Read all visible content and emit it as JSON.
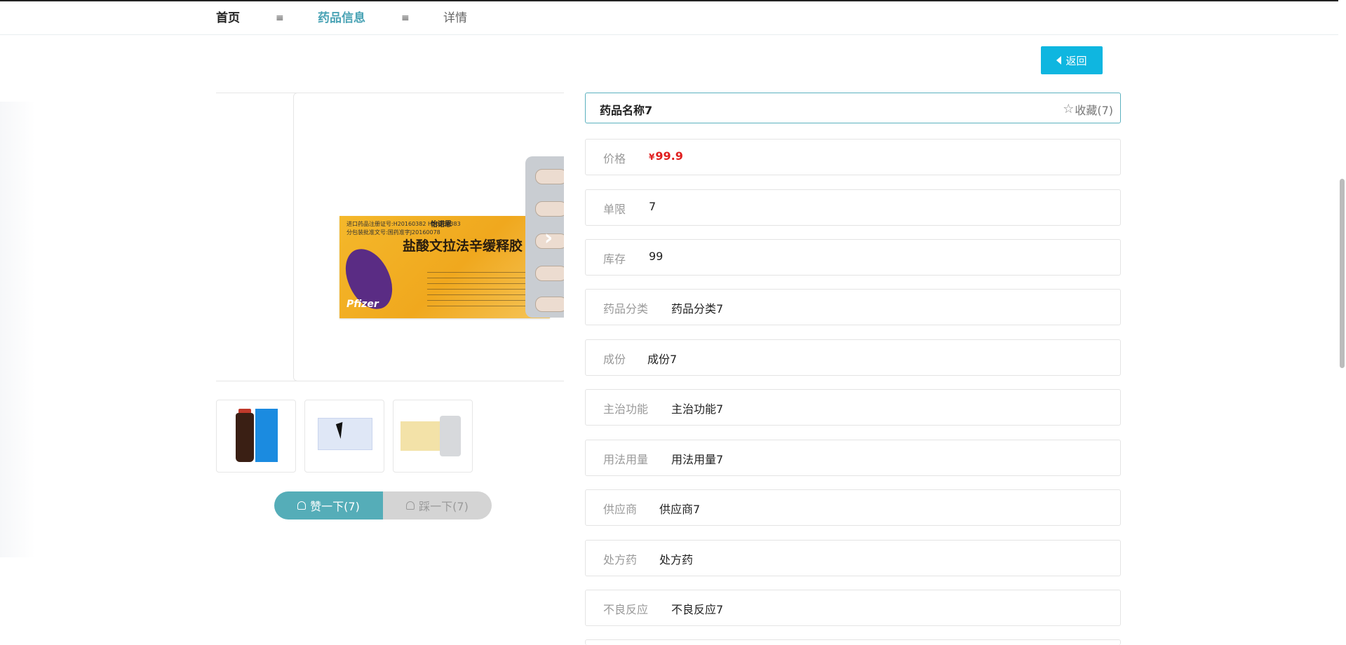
{
  "nav": {
    "home": "首页",
    "separator": "≡",
    "drug_info": "药品信息",
    "detail": "详情"
  },
  "back_button": "返回",
  "gallery": {
    "thumbnails": [
      "thumb-1",
      "thumb-2",
      "thumb-3"
    ]
  },
  "votes": {
    "like": "赞一下(7)",
    "dislike": "踩一下(7)"
  },
  "product": {
    "name": "药品名称7",
    "favorite": "收藏(7)",
    "fields": [
      {
        "label": "价格",
        "value": "99.9",
        "currency": "¥"
      },
      {
        "label": "单限",
        "value": "7"
      },
      {
        "label": "库存",
        "value": "99"
      },
      {
        "label": "药品分类",
        "value": "药品分类7"
      },
      {
        "label": "成份",
        "value": "成份7"
      },
      {
        "label": "主治功能",
        "value": "主治功能7"
      },
      {
        "label": "用法用量",
        "value": "用法用量7"
      },
      {
        "label": "供应商",
        "value": "供应商7"
      },
      {
        "label": "处方药",
        "value": "处方药"
      },
      {
        "label": "不良反应",
        "value": "不良反应7"
      }
    ]
  },
  "package_art": {
    "reg_line1": "进口药品注册证号:H20160382  H20160383",
    "reg_line2": "分包装批准文号:国药准字J20160078",
    "brand": "怡诺思",
    "drug_name": "盐酸文拉法辛缓释胶",
    "logo": "Pfizer"
  },
  "colors": {
    "accent": "#4aa3b5",
    "back_button": "#0fb6e0",
    "price": "#e02020",
    "like": "#55adb8",
    "dislike": "#d4d4d4"
  }
}
